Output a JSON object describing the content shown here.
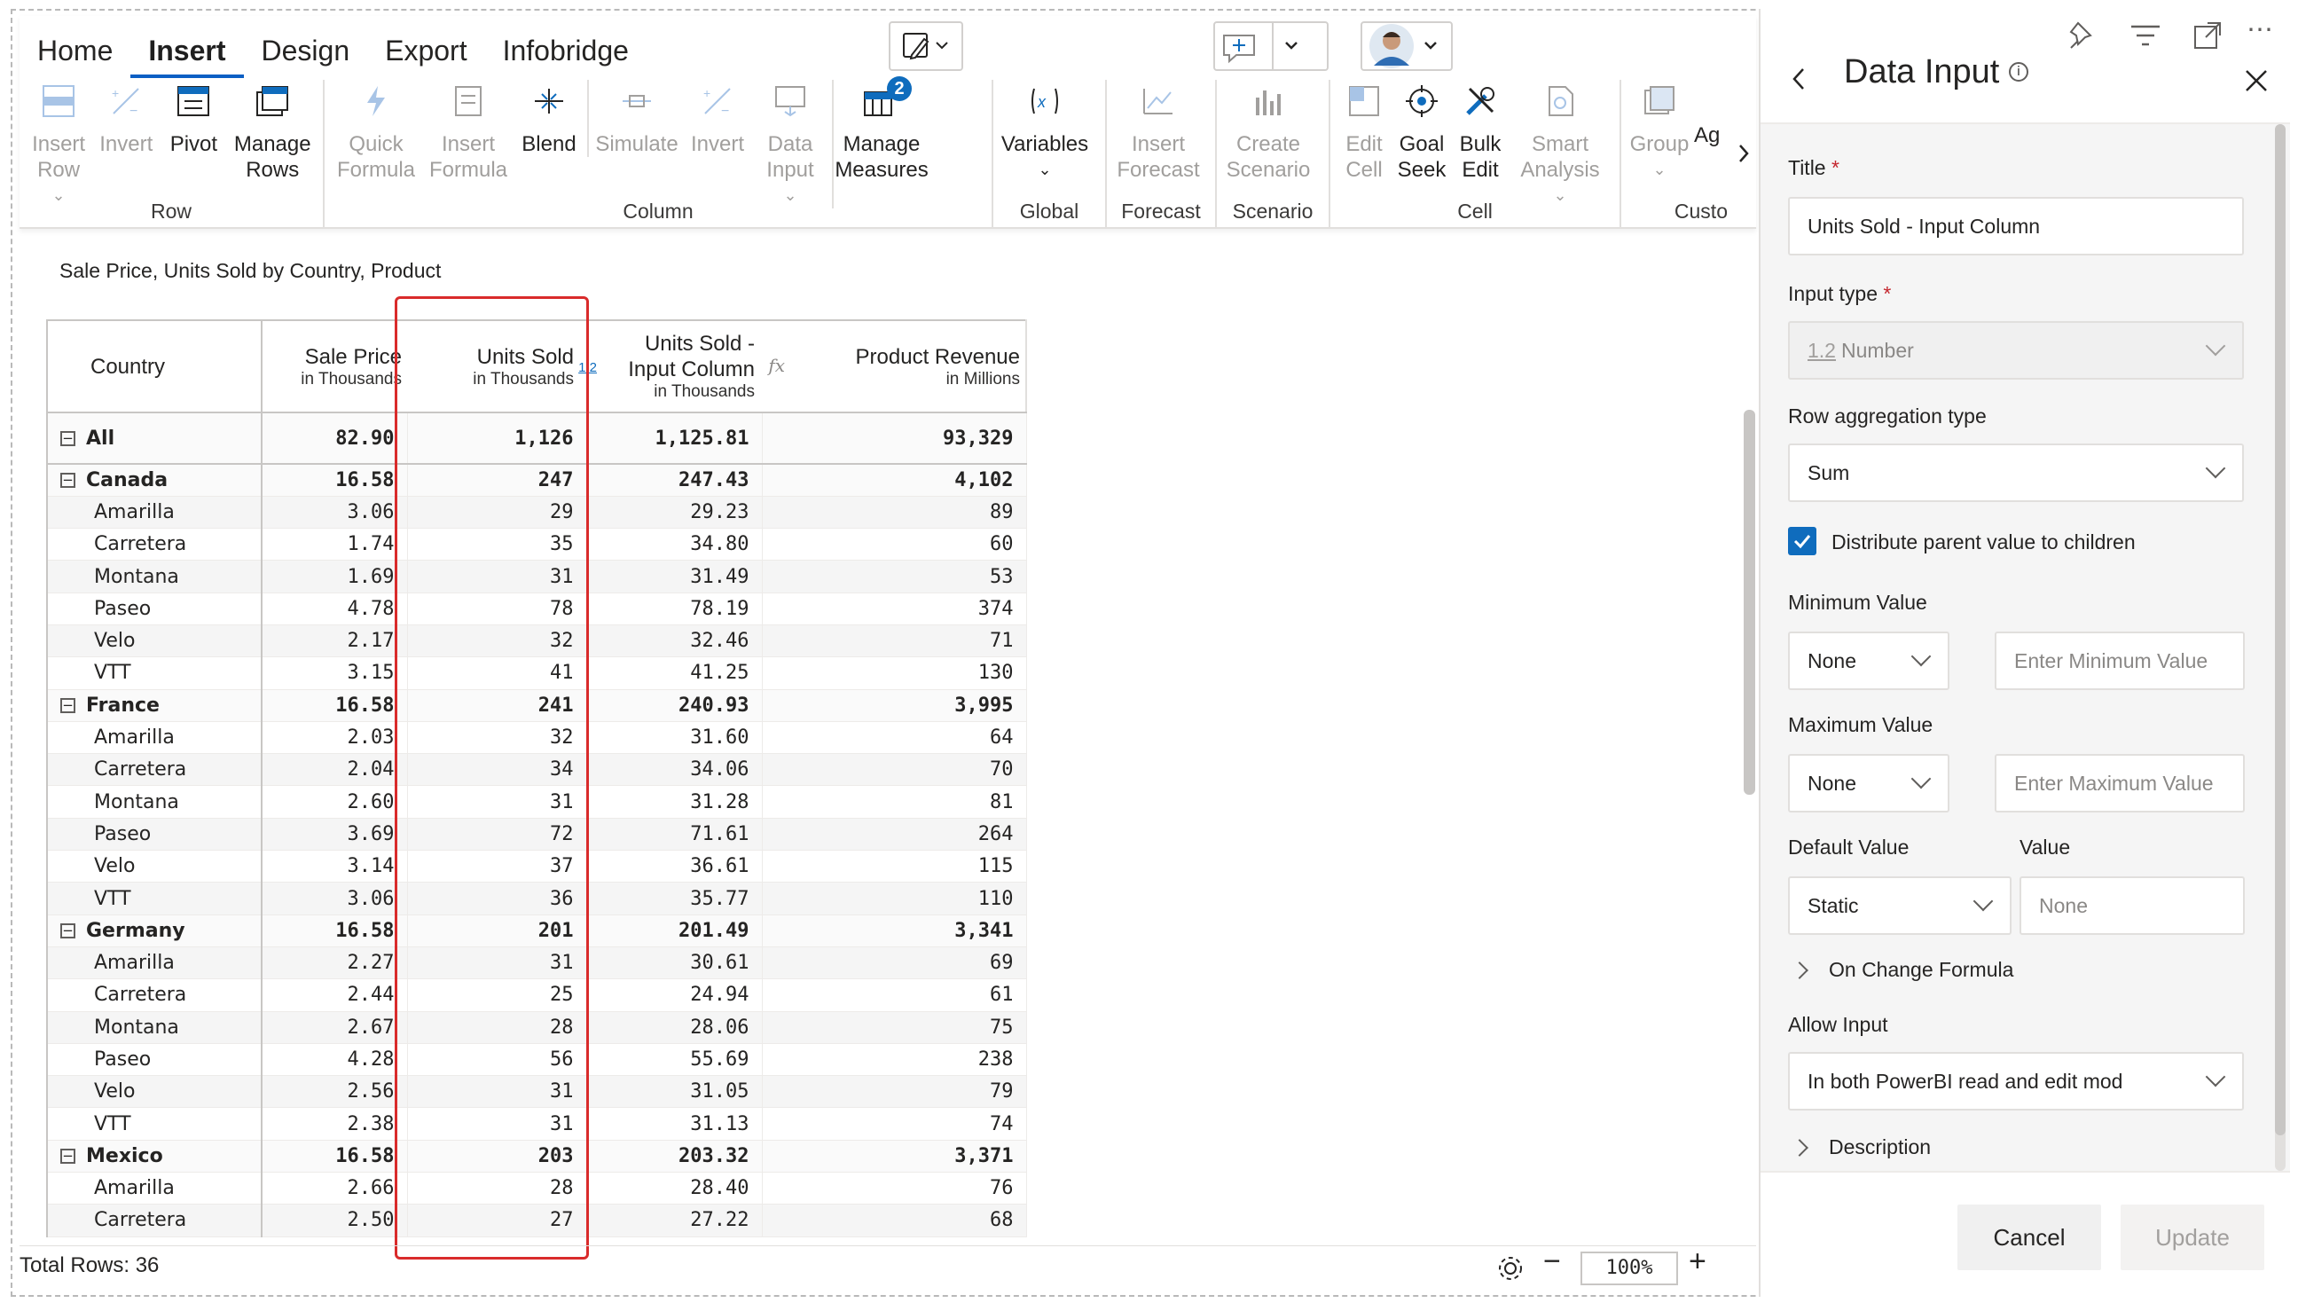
{
  "ribbon": {
    "tabs": [
      {
        "label": "Home"
      },
      {
        "label": "Insert"
      },
      {
        "label": "Design"
      },
      {
        "label": "Export"
      },
      {
        "label": "Infobridge"
      }
    ],
    "active_tab": "Insert",
    "groups": {
      "row": {
        "label": "Row",
        "buttons": {
          "insert_row": "Insert Row",
          "invert": "Invert",
          "pivot": "Pivot",
          "manage_rows": "Manage Rows"
        }
      },
      "column": {
        "label": "Column",
        "buttons": {
          "quick_formula": "Quick Formula",
          "insert_formula": "Insert Formula",
          "blend": "Blend",
          "simulate": "Simulate",
          "invert": "Invert",
          "data_input": "Data Input",
          "manage_measures": "Manage Measures",
          "measures_badge": "2"
        }
      },
      "global": {
        "label": "Global",
        "buttons": {
          "variables": "Variables"
        }
      },
      "forecast": {
        "label": "Forecast",
        "buttons": {
          "insert_forecast": "Insert Forecast"
        }
      },
      "scenario": {
        "label": "Scenario",
        "buttons": {
          "create_scenario": "Create Scenario"
        }
      },
      "cell": {
        "label": "Cell",
        "buttons": {
          "edit_cell": "Edit Cell",
          "goal_seek": "Goal Seek",
          "bulk_edit": "Bulk Edit",
          "smart_analysis": "Smart Analysis"
        }
      },
      "custom": {
        "label": "Custo",
        "buttons": {
          "group": "Group",
          "ag": "Ag"
        }
      }
    }
  },
  "table": {
    "subtitle": "Sale Price, Units Sold by Country, Product",
    "headers": {
      "country": "Country",
      "sale_price": "Sale Price",
      "sale_price_sub": "in Thousands",
      "units_sold": "Units Sold",
      "units_sold_sub": "in Thousands",
      "units_sold_badge": "1.2",
      "units_input_1": "Units Sold -",
      "units_input_2": "Input Column",
      "units_input_sub": "in Thousands",
      "fx": "fx",
      "revenue": "Product Revenue",
      "revenue_sub": "in Millions"
    },
    "rows": [
      {
        "name": "All",
        "level": 0,
        "values": [
          "82.90",
          "1,126",
          "1,125.81",
          "93,329"
        ]
      },
      {
        "name": "Canada",
        "level": 1,
        "values": [
          "16.58",
          "247",
          "247.43",
          "4,102"
        ]
      },
      {
        "name": "Amarilla",
        "level": 2,
        "values": [
          "3.06",
          "29",
          "29.23",
          "89"
        ]
      },
      {
        "name": "Carretera",
        "level": 2,
        "values": [
          "1.74",
          "35",
          "34.80",
          "60"
        ]
      },
      {
        "name": "Montana",
        "level": 2,
        "values": [
          "1.69",
          "31",
          "31.49",
          "53"
        ]
      },
      {
        "name": "Paseo",
        "level": 2,
        "values": [
          "4.78",
          "78",
          "78.19",
          "374"
        ]
      },
      {
        "name": "Velo",
        "level": 2,
        "values": [
          "2.17",
          "32",
          "32.46",
          "71"
        ]
      },
      {
        "name": "VTT",
        "level": 2,
        "values": [
          "3.15",
          "41",
          "41.25",
          "130"
        ]
      },
      {
        "name": "France",
        "level": 1,
        "values": [
          "16.58",
          "241",
          "240.93",
          "3,995"
        ]
      },
      {
        "name": "Amarilla",
        "level": 2,
        "values": [
          "2.03",
          "32",
          "31.60",
          "64"
        ]
      },
      {
        "name": "Carretera",
        "level": 2,
        "values": [
          "2.04",
          "34",
          "34.06",
          "70"
        ]
      },
      {
        "name": "Montana",
        "level": 2,
        "values": [
          "2.60",
          "31",
          "31.28",
          "81"
        ]
      },
      {
        "name": "Paseo",
        "level": 2,
        "values": [
          "3.69",
          "72",
          "71.61",
          "264"
        ]
      },
      {
        "name": "Velo",
        "level": 2,
        "values": [
          "3.14",
          "37",
          "36.61",
          "115"
        ]
      },
      {
        "name": "VTT",
        "level": 2,
        "values": [
          "3.06",
          "36",
          "35.77",
          "110"
        ]
      },
      {
        "name": "Germany",
        "level": 1,
        "values": [
          "16.58",
          "201",
          "201.49",
          "3,341"
        ]
      },
      {
        "name": "Amarilla",
        "level": 2,
        "values": [
          "2.27",
          "31",
          "30.61",
          "69"
        ]
      },
      {
        "name": "Carretera",
        "level": 2,
        "values": [
          "2.44",
          "25",
          "24.94",
          "61"
        ]
      },
      {
        "name": "Montana",
        "level": 2,
        "values": [
          "2.67",
          "28",
          "28.06",
          "75"
        ]
      },
      {
        "name": "Paseo",
        "level": 2,
        "values": [
          "4.28",
          "56",
          "55.69",
          "238"
        ]
      },
      {
        "name": "Velo",
        "level": 2,
        "values": [
          "2.56",
          "31",
          "31.05",
          "79"
        ]
      },
      {
        "name": "VTT",
        "level": 2,
        "values": [
          "2.38",
          "31",
          "31.13",
          "74"
        ]
      },
      {
        "name": "Mexico",
        "level": 1,
        "values": [
          "16.58",
          "203",
          "203.32",
          "3,371"
        ]
      },
      {
        "name": "Amarilla",
        "level": 2,
        "values": [
          "2.66",
          "28",
          "28.40",
          "76"
        ]
      },
      {
        "name": "Carretera",
        "level": 2,
        "values": [
          "2.50",
          "27",
          "27.22",
          "68"
        ]
      }
    ]
  },
  "footer": {
    "total_rows": "Total Rows: 36",
    "zoom": "100%",
    "zoom_minus": "−",
    "zoom_plus": "+"
  },
  "panel": {
    "title": "Data Input",
    "title_label": "Title",
    "title_value": "Units Sold - Input Column",
    "input_type_label": "Input type",
    "input_type_prefix": "1.2",
    "input_type_value": "Number",
    "row_agg_label": "Row aggregation type",
    "row_agg_value": "Sum",
    "distribute_label": "Distribute parent value to children",
    "min_label": "Minimum Value",
    "min_select": "None",
    "min_placeholder": "Enter Minimum Value",
    "max_label": "Maximum Value",
    "max_select": "None",
    "max_placeholder": "Enter Maximum Value",
    "default_label": "Default Value",
    "value_label": "Value",
    "default_select": "Static",
    "value_placeholder": "None",
    "on_change": "On Change Formula",
    "allow_label": "Allow Input",
    "allow_value": "In both PowerBI read and edit mod",
    "description": "Description",
    "cancel": "Cancel",
    "update": "Update"
  },
  "colors": {
    "accent": "#0f6cbd",
    "highlight": "#d92b2b",
    "tab_underline": "#0b5fc4"
  }
}
